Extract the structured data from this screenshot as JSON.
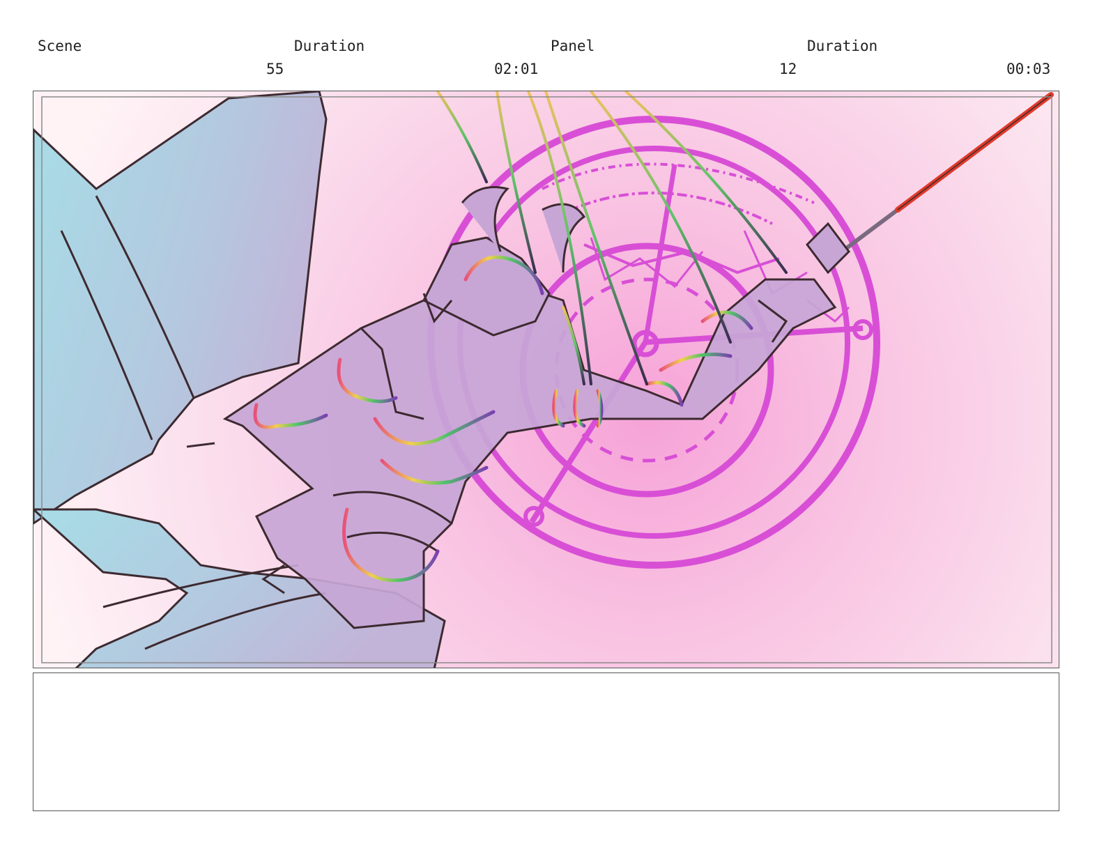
{
  "header": {
    "scene_label": "Scene",
    "scene_value": "55",
    "scene_duration_label": "Duration",
    "scene_duration_value": "02:01",
    "panel_label": "Panel",
    "panel_value": "12",
    "panel_duration_label": "Duration",
    "panel_duration_value": "00:03"
  },
  "colors": {
    "background_pink": "#f7a8d8",
    "background_light": "#fdeef3",
    "wing_blue": "#a8dbe6",
    "figure_purple": "#c7a6d6",
    "magic_circle": "#d84fd6",
    "lineart": "#3d2a30",
    "sword_red": "#e03a2a"
  },
  "notes": {
    "text": ""
  }
}
